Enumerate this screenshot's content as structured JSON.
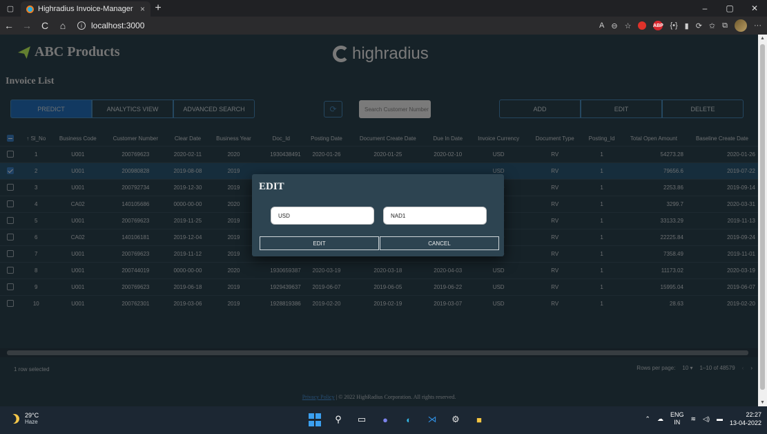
{
  "browser": {
    "tab_title": "Highradius Invoice-Manager",
    "tab_close": "×",
    "new_tab": "+",
    "url": "localhost:3000",
    "win_min": "–",
    "win_max": "▢",
    "win_close": "✕",
    "back": "←",
    "forward": "→",
    "reload": "C",
    "home": "⌂",
    "more": "···"
  },
  "header": {
    "brand": "ABC Products",
    "company_logo_text": "highradius",
    "page_title": "Invoice List"
  },
  "toolbar": {
    "predict": "PREDICT",
    "analytics_view": "ANALYTICS VIEW",
    "advanced_search": "ADVANCED SEARCH",
    "search_placeholder": "Search Customer Number",
    "add": "ADD",
    "edit": "EDIT",
    "delete": "DELETE"
  },
  "table": {
    "columns": [
      "↑ Sl_No",
      "Business Code",
      "Customer Number",
      "Clear Date",
      "Business Year",
      "Doc_Id",
      "Posting Date",
      "Document Create Date",
      "Due In Date",
      "Invoice Currency",
      "Document Type",
      "Posting_Id",
      "Total Open Amount",
      "Baseline Create Date"
    ],
    "rows": [
      {
        "selected": false,
        "cells": [
          "1",
          "U001",
          "200769623",
          "2020-02-11",
          "2020",
          "1930438491",
          "2020-01-26",
          "2020-01-25",
          "2020-02-10",
          "USD",
          "RV",
          "1",
          "54273.28",
          "2020-01-26"
        ]
      },
      {
        "selected": true,
        "cells": [
          "2",
          "U001",
          "200980828",
          "2019-08-08",
          "2019",
          "",
          "",
          "",
          "",
          "USD",
          "RV",
          "1",
          "79656.6",
          "2019-07-22"
        ]
      },
      {
        "selected": false,
        "cells": [
          "3",
          "U001",
          "200792734",
          "2019-12-30",
          "2019",
          "",
          "",
          "",
          "",
          "USD",
          "RV",
          "1",
          "2253.86",
          "2019-09-14"
        ]
      },
      {
        "selected": false,
        "cells": [
          "4",
          "CA02",
          "140105686",
          "0000-00-00",
          "2020",
          "",
          "",
          "",
          "",
          "CAD",
          "RV",
          "1",
          "3299.7",
          "2020-03-31"
        ]
      },
      {
        "selected": false,
        "cells": [
          "5",
          "U001",
          "200769623",
          "2019-11-25",
          "2019",
          "",
          "",
          "",
          "",
          "USD",
          "RV",
          "1",
          "33133.29",
          "2019-11-13"
        ]
      },
      {
        "selected": false,
        "cells": [
          "6",
          "CA02",
          "140106181",
          "2019-12-04",
          "2019",
          "",
          "",
          "",
          "",
          "CAD",
          "RV",
          "1",
          "22225.84",
          "2019-09-24"
        ]
      },
      {
        "selected": false,
        "cells": [
          "7",
          "U001",
          "200769623",
          "2019-11-12",
          "2019",
          "1930083373",
          "2019-11-01",
          "2019-10-31",
          "2019-11-16",
          "USD",
          "RV",
          "1",
          "7358.49",
          "2019-11-01"
        ]
      },
      {
        "selected": false,
        "cells": [
          "8",
          "U001",
          "200744019",
          "0000-00-00",
          "2020",
          "1930659387",
          "2020-03-19",
          "2020-03-18",
          "2020-04-03",
          "USD",
          "RV",
          "1",
          "11173.02",
          "2020-03-19"
        ]
      },
      {
        "selected": false,
        "cells": [
          "9",
          "U001",
          "200769623",
          "2019-06-18",
          "2019",
          "1929439637",
          "2019-06-07",
          "2019-06-05",
          "2019-06-22",
          "USD",
          "RV",
          "1",
          "15995.04",
          "2019-06-07"
        ]
      },
      {
        "selected": false,
        "cells": [
          "10",
          "U001",
          "200762301",
          "2019-03-06",
          "2019",
          "1928819386",
          "2019-02-20",
          "2019-02-19",
          "2019-03-07",
          "USD",
          "RV",
          "1",
          "28.63",
          "2019-02-20"
        ]
      }
    ]
  },
  "footer": {
    "selection": "1 row selected",
    "rows_per_page_label": "Rows per page:",
    "rows_per_page_value": "10",
    "range": "1–10 of 48579",
    "privacy": "Privacy Policy",
    "copyright": "| © 2022 HighRadius Corporation. All rights reserved."
  },
  "dialog": {
    "title": "EDIT",
    "currency_value": "USD",
    "terms_value": "NAD1",
    "edit_button": "EDIT",
    "cancel_button": "CANCEL"
  },
  "taskbar": {
    "temperature": "29°C",
    "condition": "Haze",
    "lang": "ENG",
    "region": "IN",
    "time": "22:27",
    "date": "13-04-2022"
  },
  "colors": {
    "page_bg": "#2d4451",
    "accent": "#2573c2",
    "border_blue": "#4b8ec1",
    "selected_row": "#2c5a78"
  }
}
